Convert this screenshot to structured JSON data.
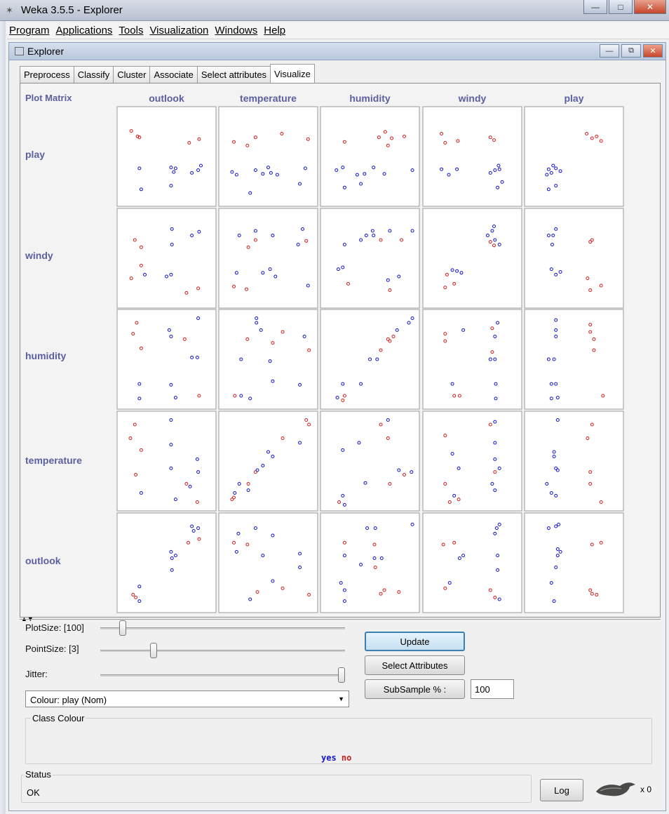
{
  "window": {
    "title": "Weka 3.5.5 - Explorer"
  },
  "menu": [
    "Program",
    "Applications",
    "Tools",
    "Visualization",
    "Windows",
    "Help"
  ],
  "frame": {
    "title": "Explorer"
  },
  "tabs": [
    {
      "label": "Preprocess",
      "active": false
    },
    {
      "label": "Classify",
      "active": false
    },
    {
      "label": "Cluster",
      "active": false
    },
    {
      "label": "Associate",
      "active": false
    },
    {
      "label": "Select attributes",
      "active": false
    },
    {
      "label": "Visualize",
      "active": true
    }
  ],
  "plot_matrix": {
    "label": "Plot Matrix",
    "columns": [
      "outlook",
      "temperature",
      "humidity",
      "windy",
      "play"
    ],
    "rows": [
      "play",
      "windy",
      "humidity",
      "temperature",
      "outlook"
    ],
    "colors": {
      "yes": "#1414c8",
      "no": "#d21e1e"
    }
  },
  "controls": {
    "plot_size": {
      "label": "PlotSize: [100]",
      "level": 0.08
    },
    "point_size": {
      "label": "PointSize: [3]",
      "level": 0.21
    },
    "jitter": {
      "label": "Jitter:",
      "level": 1.0
    },
    "colour": "Colour: play  (Nom)",
    "update_label": "Update",
    "select_attributes_label": "Select Attributes",
    "subsample_label": "SubSample % :",
    "subsample_value": "100"
  },
  "class_colour": {
    "title": "Class Colour",
    "legend": [
      {
        "label": "yes",
        "color": "#1414c8"
      },
      {
        "label": "no",
        "color": "#d21e1e"
      }
    ]
  },
  "status": {
    "title": "Status",
    "text": "OK",
    "log_label": "Log",
    "task_count": "x 0"
  }
}
